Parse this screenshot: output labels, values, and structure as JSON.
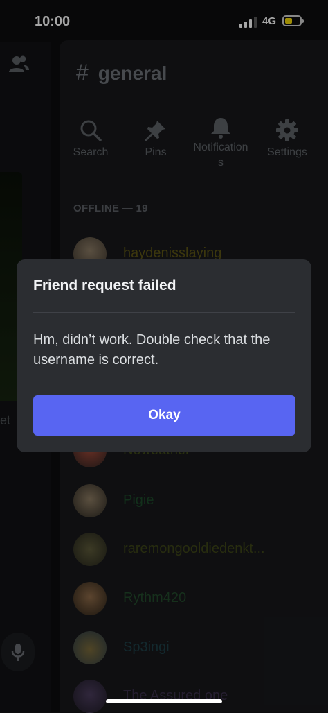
{
  "status_bar": {
    "time": "10:00",
    "network": "4G",
    "battery_color": "#f5d90a"
  },
  "left_panel": {
    "edge_text": "et"
  },
  "channel": {
    "name": "general",
    "actions": [
      {
        "icon": "search-icon",
        "label": "Search"
      },
      {
        "icon": "pin-icon",
        "label": "Pins"
      },
      {
        "icon": "bell-icon",
        "label": "Notification\ns"
      },
      {
        "icon": "gear-icon",
        "label": "Settings"
      }
    ],
    "section_header": "OFFLINE — 19",
    "members": [
      {
        "name": "haydenisslaying",
        "color": "#5c5515"
      },
      {
        "name": "Noweather",
        "color": "#3f4a17"
      },
      {
        "name": "Pigie",
        "color": "#1d4b2a"
      },
      {
        "name": "raremongooldiedenkt...",
        "color": "#3e4618"
      },
      {
        "name": "Rythm420",
        "color": "#234a2c"
      },
      {
        "name": "Sp3ingi",
        "color": "#1e3f47"
      },
      {
        "name": "The Assured one",
        "color": "#3a2f4a"
      }
    ]
  },
  "dialog": {
    "title": "Friend request failed",
    "message": "Hm, didn’t work. Double check that the username is correct.",
    "button": "Okay",
    "button_color": "#5865f2"
  }
}
